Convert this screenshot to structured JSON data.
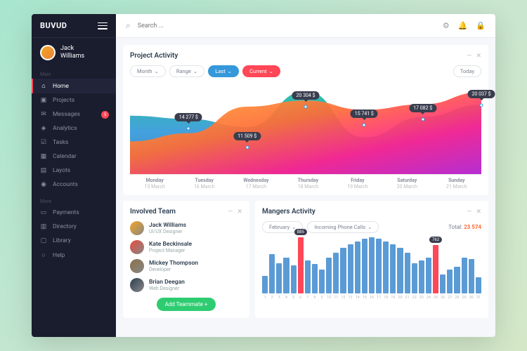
{
  "brand": "BUVUD",
  "user": {
    "first": "Jack",
    "last": "Williams"
  },
  "nav": {
    "main_label": "Main",
    "more_label": "More",
    "main": [
      {
        "icon": "⌂",
        "label": "Home",
        "active": true
      },
      {
        "icon": "▣",
        "label": "Projects"
      },
      {
        "icon": "✉",
        "label": "Messages",
        "badge": "5"
      },
      {
        "icon": "◈",
        "label": "Analytics"
      },
      {
        "icon": "☑",
        "label": "Tasks"
      },
      {
        "icon": "▦",
        "label": "Calendar"
      },
      {
        "icon": "▤",
        "label": "Layots"
      },
      {
        "icon": "◉",
        "label": "Accounts"
      }
    ],
    "more": [
      {
        "icon": "▭",
        "label": "Payments"
      },
      {
        "icon": "▥",
        "label": "Directory"
      },
      {
        "icon": "▢",
        "label": "Library"
      },
      {
        "icon": "○",
        "label": "Help"
      }
    ]
  },
  "search": {
    "placeholder": "Search ..."
  },
  "activity": {
    "title": "Project Activity",
    "filters": {
      "month": "Month",
      "range": "Range",
      "last": "Last",
      "current": "Current",
      "today": "Today"
    }
  },
  "chart_data": {
    "type": "area",
    "xlabel": "",
    "ylabel": "$",
    "categories": [
      {
        "day": "Monday",
        "date": "15 March"
      },
      {
        "day": "Tuesday",
        "date": "16 March"
      },
      {
        "day": "Wednesday",
        "date": "17 March"
      },
      {
        "day": "Thursday",
        "date": "18 March"
      },
      {
        "day": "Friday",
        "date": "19 March"
      },
      {
        "day": "Saturday",
        "date": "20 March"
      },
      {
        "day": "Sunday",
        "date": "21 March"
      }
    ],
    "series": [
      {
        "name": "Last",
        "color": "#3498db",
        "values": [
          14277,
          13500,
          11509,
          20304,
          9000,
          14000,
          17000
        ]
      },
      {
        "name": "Current",
        "color": "#ff4da6",
        "values": [
          8000,
          10000,
          16500,
          18000,
          15741,
          17082,
          20037
        ]
      }
    ],
    "tooltips": [
      {
        "x": 1,
        "label": "14 277 $",
        "y": 55
      },
      {
        "x": 2,
        "label": "11 509 $",
        "y": 82
      },
      {
        "x": 3,
        "label": "20 304 $",
        "y": 24
      },
      {
        "x": 4,
        "label": "15 741 $",
        "y": 50
      },
      {
        "x": 5,
        "label": "17 082 $",
        "y": 42
      },
      {
        "x": 6,
        "label": "20 037 $",
        "y": 22
      }
    ]
  },
  "team": {
    "title": "Involved Team",
    "members": [
      {
        "name": "Jack Williams",
        "role": "UI/UX Designer",
        "color": "#f5a623"
      },
      {
        "name": "Kate Beckinsale",
        "role": "Project Manager",
        "color": "#e74c3c"
      },
      {
        "name": "Mickey Thompson",
        "role": "Developer",
        "color": "#8b6f47"
      },
      {
        "name": "Brian Deegan",
        "role": "Web Designer",
        "color": "#2c3e50"
      }
    ],
    "add_label": "Add Teammate +"
  },
  "managers": {
    "title": "Mangers Activity",
    "month": "February",
    "metric": "Incoming Phone Calls",
    "total_label": "Total:",
    "total": "23 574",
    "bars": {
      "type": "bar",
      "categories": [
        1,
        2,
        3,
        4,
        5,
        6,
        7,
        8,
        9,
        10,
        11,
        12,
        13,
        14,
        15,
        16,
        17,
        18,
        19,
        20,
        21,
        22,
        23,
        24,
        25,
        26,
        27,
        28,
        29,
        30,
        31
      ],
      "values": [
        280,
        620,
        480,
        560,
        440,
        885,
        520,
        460,
        380,
        560,
        640,
        720,
        780,
        820,
        860,
        880,
        860,
        820,
        780,
        720,
        640,
        480,
        520,
        560,
        762,
        300,
        380,
        420,
        560,
        540,
        260
      ],
      "highlights": [
        {
          "i": 5,
          "label": "885"
        },
        {
          "i": 24,
          "label": "762"
        }
      ]
    }
  }
}
